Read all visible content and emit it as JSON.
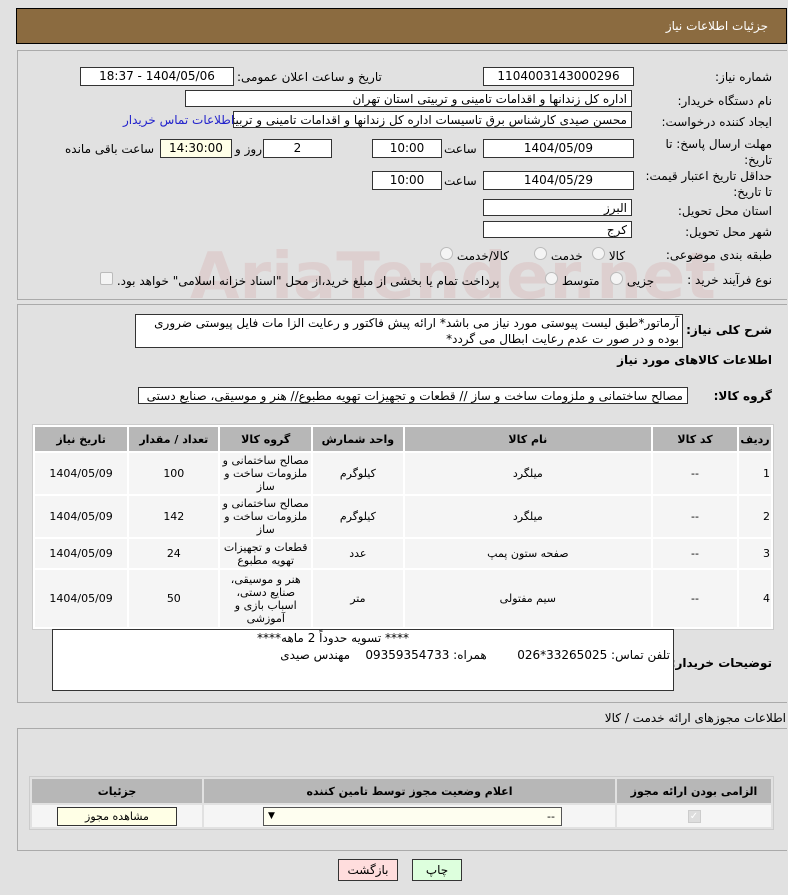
{
  "header": {
    "title": "جزئیات اطلاعات نیاز"
  },
  "watermark": "AriaTender.net",
  "fields": {
    "need_number_label": "شماره نیاز:",
    "need_number": "1104003143000296",
    "announce_label": "تاریخ و ساعت اعلان عمومی:",
    "announce_value": "1404/05/06 - 18:37",
    "buyer_org_label": "نام دستگاه خریدار:",
    "buyer_org": "اداره کل زندانها و اقدامات تامینی و تربیتی استان تهران",
    "creator_label": "ایجاد کننده درخواست:",
    "creator": "محسن صیدی کارشناس برق تاسیسات  اداره کل زندانها و اقدامات تامینی و تربیتی",
    "contact_link": "اطلاعات تماس خریدار",
    "deadline_label": "مهلت ارسال پاسخ: تا تاریخ:",
    "deadline_date": "1404/05/09",
    "time_label": "ساعت",
    "deadline_time": "10:00",
    "days": "2",
    "days_label": "روز و",
    "remaining": "14:30:00",
    "remaining_label": "ساعت باقی مانده",
    "validity_label": "حداقل تاریخ اعتبار قیمت: تا تاریخ:",
    "validity_date": "1404/05/29",
    "validity_time": "10:00",
    "province_label": "استان محل تحویل:",
    "province": "البرز",
    "city_label": "شهر محل تحویل:",
    "city": "کرج",
    "category_label": "طبقه بندی موضوعی:",
    "category_options": [
      "کالا",
      "خدمت",
      "کالا/خدمت"
    ],
    "process_label": "نوع فرآیند خرید :",
    "process_options": [
      "جزیی",
      "متوسط"
    ],
    "payment_note": "پرداخت تمام یا بخشی از مبلغ خرید،از محل \"اسناد خزانه اسلامی\" خواهد بود."
  },
  "description": {
    "label": "شرح کلی نیاز:",
    "text": "آرماتور*طبق لیست پیوستی مورد نیاز می باشد* ارائه پیش فاکتور و رعایت الزا مات فایل پیوستی ضروری بوده و در صور ت عدم رعایت ابطال می گردد*"
  },
  "goods": {
    "title": "اطلاعات کالاهای مورد نیاز",
    "group_label": "گروه کالا:",
    "group_value": "مصالح ساختمانی و ملزومات ساخت و ساز //  قطعات و تجهیزات تهویه مطبوع// هنر و موسیقی، صنایع دستی",
    "columns": [
      "ردیف",
      "کد کالا",
      "نام کالا",
      "واحد شمارش",
      "گروه کالا",
      "تعداد / مقدار",
      "تاریخ نیاز"
    ],
    "rows": [
      [
        "1",
        "--",
        "میلگرد",
        "کیلوگرم",
        "مصالح ساختمانی و ملزومات ساخت و ساز",
        "100",
        "1404/05/09"
      ],
      [
        "2",
        "--",
        "میلگرد",
        "کیلوگرم",
        "مصالح ساختمانی و ملزومات ساخت و ساز",
        "142",
        "1404/05/09"
      ],
      [
        "3",
        "--",
        "صفحه ستون پمپ",
        "عدد",
        "قطعات و تجهیزات تهویه مطبوع",
        "24",
        "1404/05/09"
      ],
      [
        "4",
        "--",
        "سیم مفتولی",
        "متر",
        "هنر و موسیقی، صنایع دستی، اسباب بازی و آموزشی",
        "50",
        "1404/05/09"
      ]
    ]
  },
  "buyer_notes": {
    "label": "توضیحات خریدار:",
    "line1": "**** تسویه حدوداً 2 ماهه****",
    "line2": "تلفن تماس: 33265025*026        همراه: 09359354733    مهندس صیدی"
  },
  "licenses": {
    "title": "اطلاعات مجوزهای ارائه خدمت / کالا",
    "columns": [
      "الزامی بودن ارائه مجوز",
      "اعلام وضعیت مجوز توسط تامین کننده",
      "جزئیات"
    ],
    "select_value": "--",
    "view_button": "مشاهده مجوز"
  },
  "buttons": {
    "back": "بازگشت",
    "print": "چاپ"
  }
}
